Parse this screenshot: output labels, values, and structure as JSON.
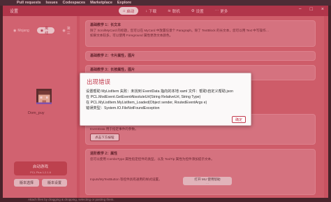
{
  "github_bar": {
    "items": [
      "Pull requests",
      "Issues",
      "Codespaces",
      "Marketplace",
      "Explore"
    ]
  },
  "app": {
    "title": "设置",
    "nav_tabs": [
      {
        "label": "启动",
        "icon": "home-icon",
        "active": true
      },
      {
        "label": "下载",
        "icon": "download-icon",
        "active": false
      },
      {
        "label": "联机",
        "icon": "wifi-icon",
        "active": false
      },
      {
        "label": "设置",
        "icon": "gear-icon",
        "active": false
      },
      {
        "label": "更多",
        "icon": "more-icon",
        "active": false
      }
    ],
    "window_controls": [
      "−",
      "□",
      "×"
    ]
  },
  "sidebar": {
    "tabs": [
      {
        "label": "Mojang",
        "active": false
      },
      {
        "label": "离线",
        "active": true
      },
      {
        "label": "第三",
        "active": false
      }
    ],
    "avatar_name": "Dom_puy",
    "start_button": "启动游戏",
    "start_version": "PCL Plus 1.2.1.6",
    "sub_buttons": [
      "版本选择",
      "版本设置"
    ]
  },
  "cards": [
    {
      "heading": "基础教学 1：长文本",
      "lines": [
        "除了 ScrollMyCard 的标题，您可以在 MyCard 中放置任意个 Paragraph。除了 TextBlock 的长文本，您可以用 Text 中写操作…",
        "如果文本较多，可以使用 Foreground 属性更改文本颜色。"
      ]
    },
    {
      "heading": "基础教学 2：卡片属性，图片",
      "lines": []
    },
    {
      "heading": "基础教学 3：长按属性，图片",
      "lines": [
        "您可以使用 Image 控件展示图片，可以通过 Width 与 Height 控制尺寸。",
        "…"
      ]
    },
    {
      "heading": "进阶教学 1：EventType",
      "lines": [
        "通过 EventType 属性可以为控件添加点击事件，比如打开网页或启动游戏。",
        "EventData 用于指定事件的参数。"
      ],
      "button": "点击下方按钮"
    },
    {
      "heading": "进阶教学 2：属性",
      "lines": [
        "您可以使用 ComboType 属性指定控件的类型，以及 ToolTip 属性为控件添加提示文本。",
        "Inputs/MyTextButton 等控件具有通用的样式设置。"
      ]
    }
  ],
  "middle_button": {
    "label": "打开 MU 使用帮助",
    "sub": "…"
  },
  "error_dialog": {
    "title": "出现错误",
    "lines": [
      "设置帮助 MyListItem 失败：未找到 EventData 指向的本地 xaml 文件：帮助\\自定义帮助.json",
      "   在 PCL.ModEvent.GetEventAbsoluteUrl(String RelativeUrl, String Type)",
      "   在 PCL.MyListItem.MyListItem_Loaded(Object sender, RoutedEventArgs e)",
      "错误类型：System.IO.FileNotFoundException"
    ],
    "ok_label": "确定"
  },
  "status_bar": "Attach files by dragging & dropping, selecting or pasting them.",
  "colors": {
    "titlebar": "#a8344a",
    "content": "#cf6873",
    "dialog_accent": "#c23a4d"
  }
}
